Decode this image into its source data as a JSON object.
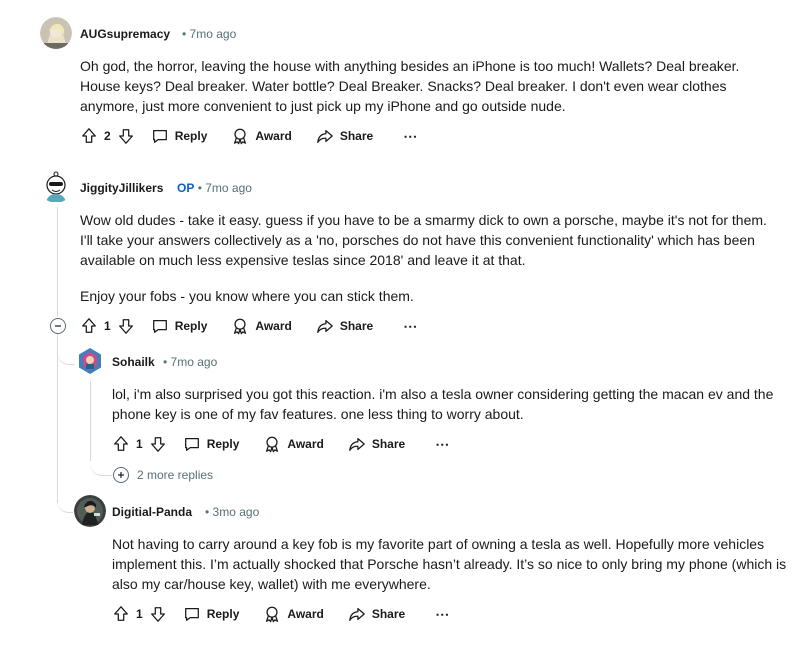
{
  "comments": [
    {
      "author": "AUGsupremacy",
      "time": "7mo ago",
      "body": "Oh god, the horror, leaving the house with anything besides an iPhone is too much! Wallets? Deal breaker. House keys? Deal breaker. Water bottle? Deal Breaker. Snacks? Deal breaker. I don't even wear clothes anymore, just more convenient to just pick up my iPhone and go outside nude.",
      "votes": "2"
    },
    {
      "author": "JiggityJillikers",
      "op_badge": "OP",
      "time": "7mo ago",
      "body": "Wow old dudes - take it easy. guess if you have to be a smarmy dick to own a porsche, maybe it's not for them. I'll take your answers collectively as a 'no, porsches do not have this convenient functionality' which has been available on much less expensive teslas since 2018' and leave it at that.",
      "body2": "Enjoy your fobs - you know where you can stick them.",
      "votes": "1"
    },
    {
      "author": "Sohailk",
      "time": "7mo ago",
      "body": "lol, i'm also surprised you got this reaction. i'm also a tesla owner considering getting the macan ev and the phone key is one of my fav features. one less thing to worry about.",
      "votes": "1",
      "more_replies": "2 more replies"
    },
    {
      "author": "Digitial-Panda",
      "time": "3mo ago",
      "body": "Not having to carry around a key fob is my favorite part of owning a tesla as well. Hopefully more vehicles implement this. I’m actually shocked that Porsche hasn’t already. It’s so nice to only bring my phone (which is also my car/house key, wallet) with me everywhere.",
      "votes": "1"
    }
  ],
  "actions": {
    "reply": "Reply",
    "award": "Award",
    "share": "Share",
    "more": "⋯"
  },
  "separator": "•",
  "icons": [
    "upvote-icon",
    "downvote-icon",
    "reply-icon",
    "award-icon",
    "share-icon",
    "more-icon",
    "collapse-icon",
    "expand-icon"
  ],
  "colors": {
    "op": "#0a62c9",
    "meta": "#576f76",
    "thread": "#d6dadc"
  }
}
